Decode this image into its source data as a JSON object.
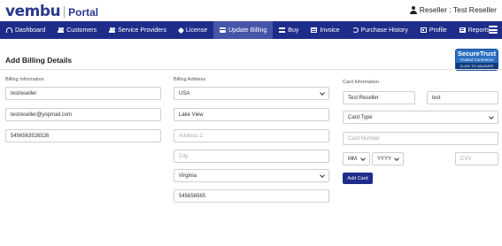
{
  "header": {
    "logo_text": "vembu",
    "portal_label": "Portal",
    "user_label": "Reseller : Test Reseller"
  },
  "nav": {
    "items": [
      {
        "label": "Dashboard",
        "icon": "dashboard-icon"
      },
      {
        "label": "Customers",
        "icon": "users-icon"
      },
      {
        "label": "Service Providers",
        "icon": "users-icon"
      },
      {
        "label": "License",
        "icon": "tag-icon"
      },
      {
        "label": "Update Billing",
        "icon": "credit-card-icon",
        "active": true
      },
      {
        "label": "Buy",
        "icon": "cart-icon"
      },
      {
        "label": "Invoice",
        "icon": "invoice-icon"
      },
      {
        "label": "Purchase History",
        "icon": "history-icon"
      },
      {
        "label": "Profile",
        "icon": "profile-icon"
      },
      {
        "label": "Reports",
        "icon": "reports-icon"
      }
    ],
    "active_color": "#4655a8",
    "bar_color": "#1f2d8a"
  },
  "page": {
    "title": "Add Billing Details"
  },
  "trust_badge": {
    "line1": "SecureTrust",
    "line2": "Trusted Commerce",
    "line3": "CLICK TO VALIDATE"
  },
  "billing_info": {
    "label": "Billing Information",
    "name": "testreseller",
    "email": "testreseller@yopmail.com",
    "phone": "5456563526526"
  },
  "billing_address": {
    "label": "Billing Address",
    "country": "USA",
    "address1": "Lake View",
    "address2_placeholder": "Address 2",
    "city_placeholder": "City",
    "state": "Virginia",
    "zip": "545656565"
  },
  "card_info": {
    "label": "Card Information",
    "first_name": "Test Reseller",
    "last_name": "test",
    "card_type": "Card Type",
    "card_number_placeholder": "Card Number",
    "month": "MM",
    "year": "YYYY",
    "cvv_placeholder": "CVV",
    "add_button": "Add Card"
  }
}
